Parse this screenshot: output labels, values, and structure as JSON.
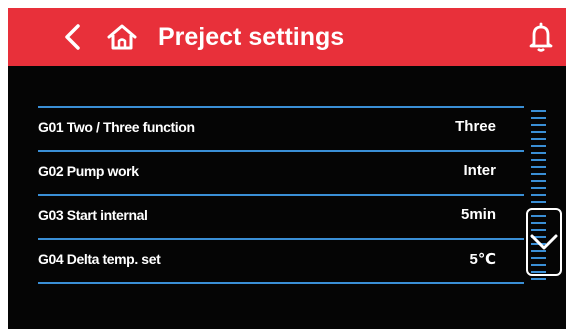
{
  "header": {
    "title": "Preject settings",
    "back_icon": "chevron-left-icon",
    "home_icon": "home-icon",
    "bell_icon": "bell-icon"
  },
  "settings": [
    {
      "label": "G01 Two / Three function",
      "value": "Three"
    },
    {
      "label": "G02 Pump work",
      "value": "Inter"
    },
    {
      "label": "G03 Start internal",
      "value": "5min"
    },
    {
      "label": "G04 Delta temp. set",
      "value": "5℃"
    }
  ],
  "scroll_down_icon": "chevron-down-icon",
  "colors": {
    "header": "#e8303a",
    "panel": "#050505",
    "accent": "#3a8fd6",
    "text": "#ffffff"
  }
}
